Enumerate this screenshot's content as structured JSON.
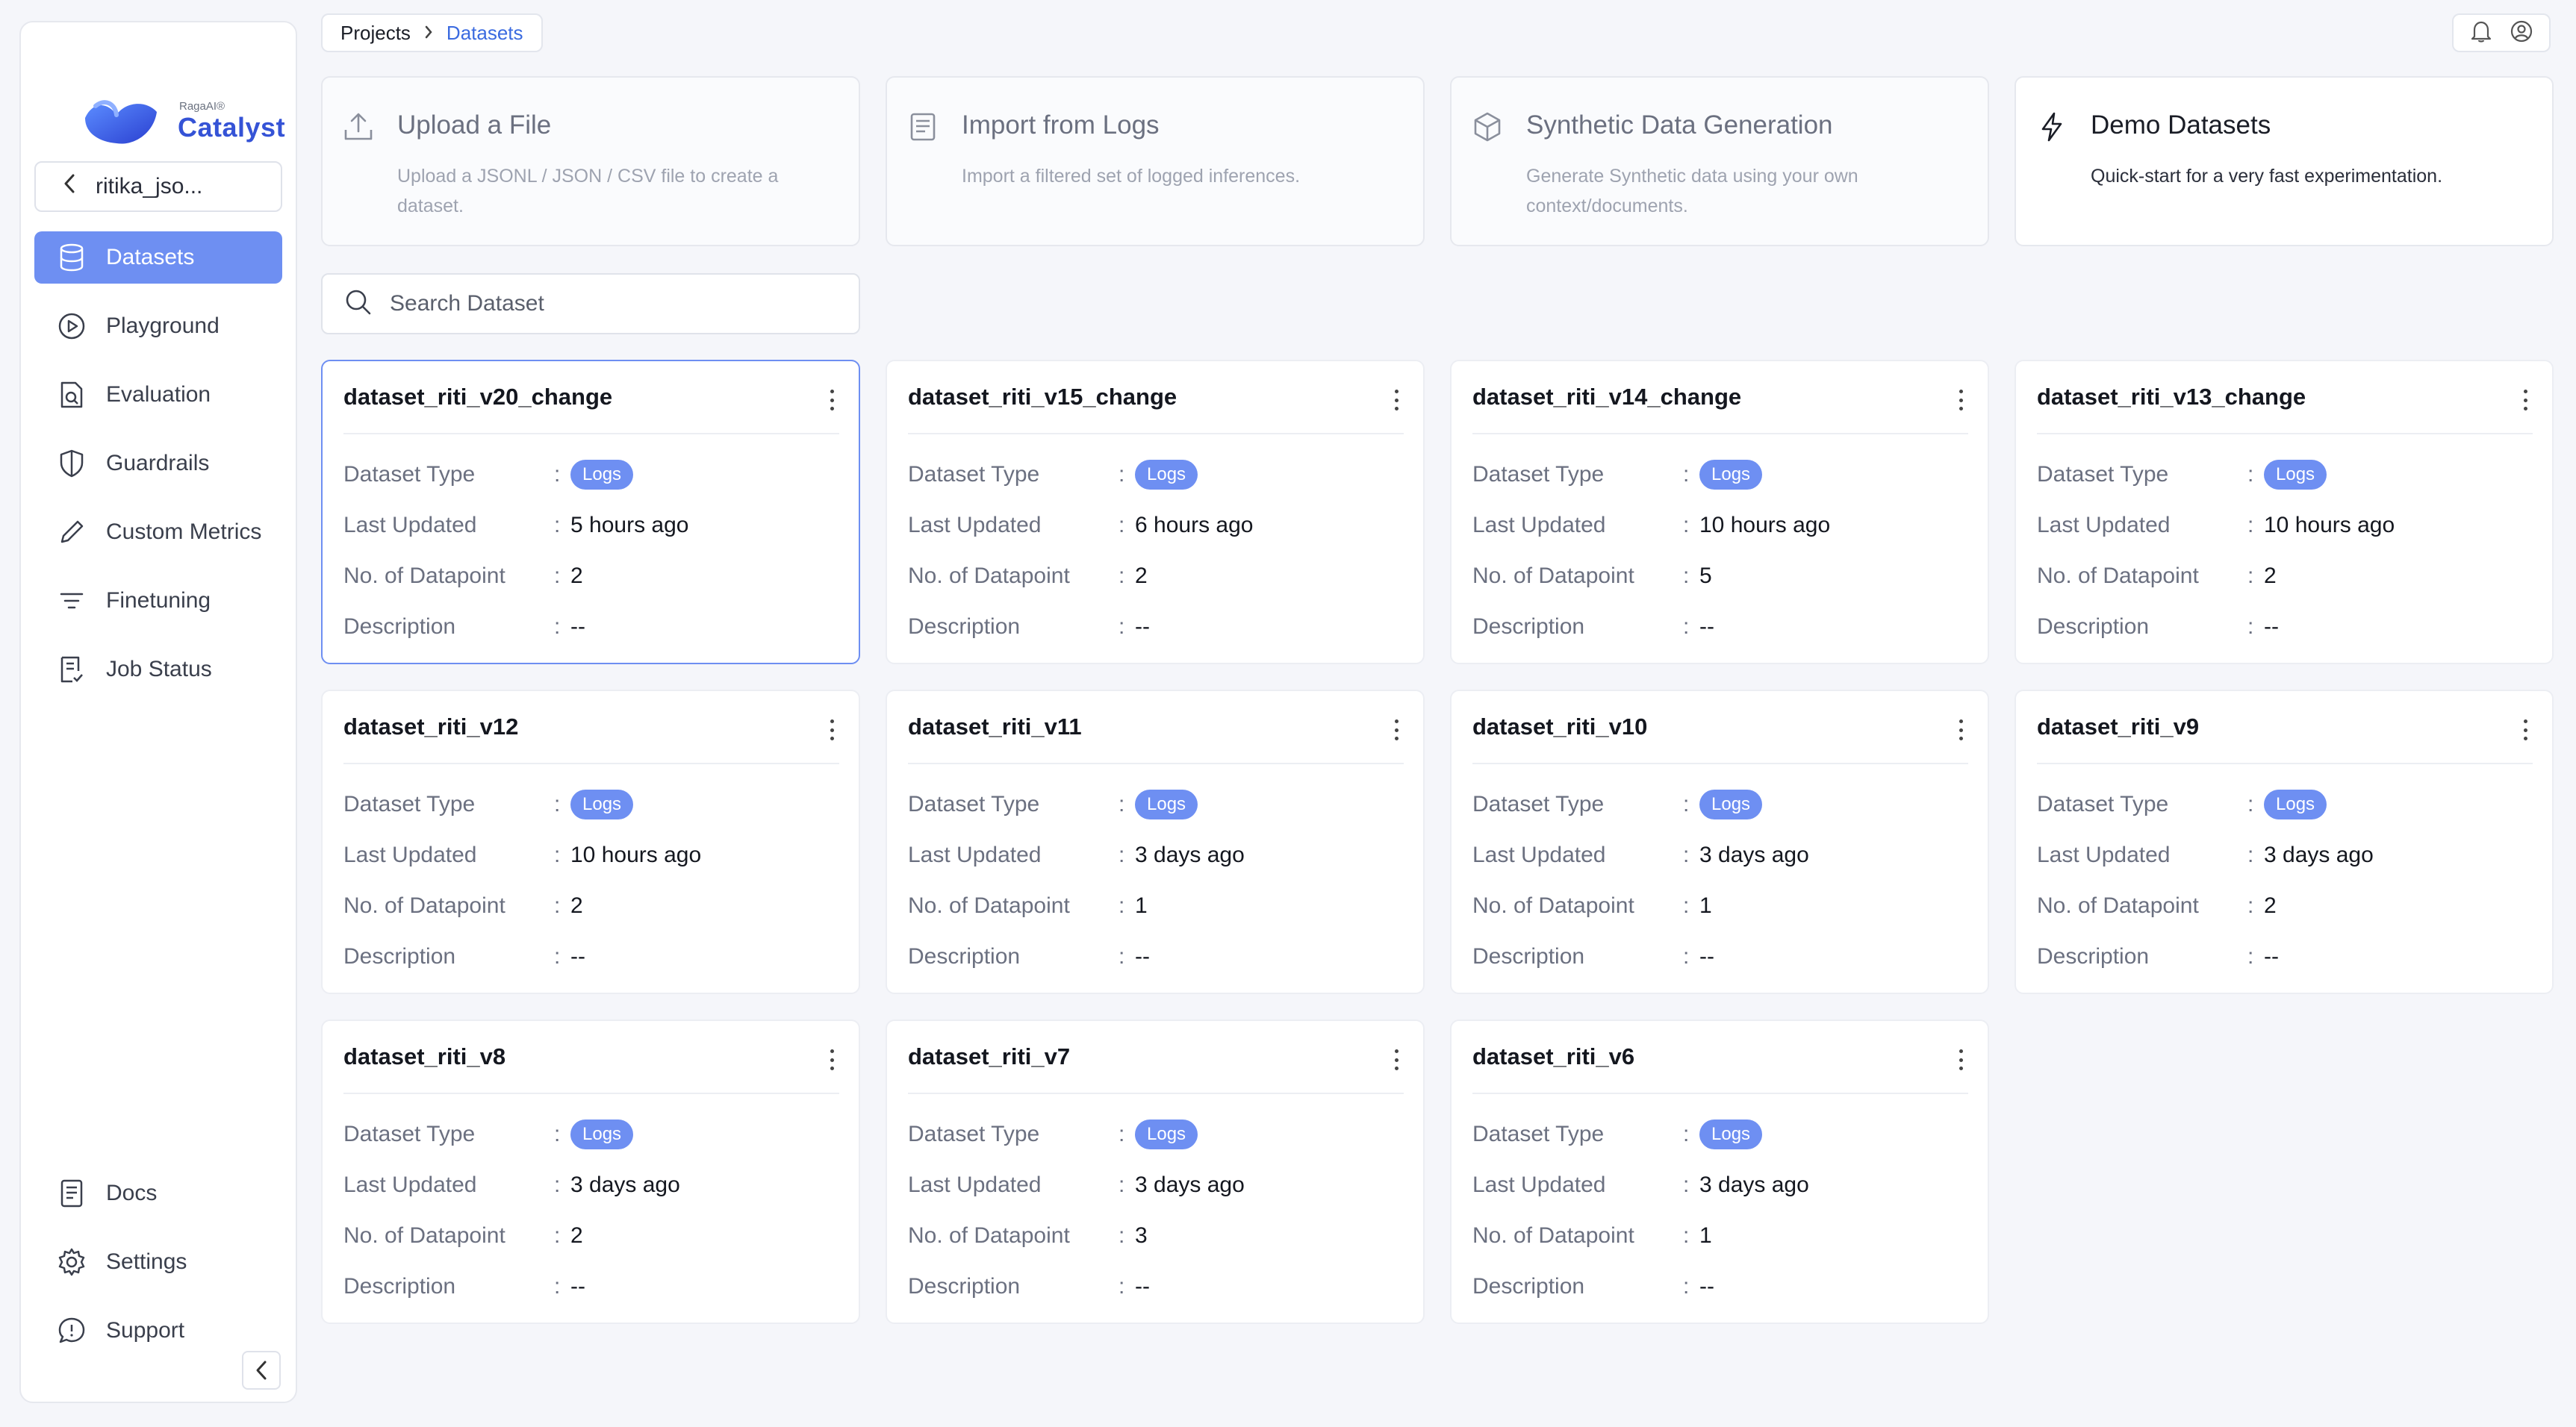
{
  "brand": {
    "small": "RagaAI®",
    "name": "Catalyst"
  },
  "project": {
    "name": "ritika_jso..."
  },
  "nav": {
    "items": [
      {
        "label": "Datasets",
        "icon": "database-icon"
      },
      {
        "label": "Playground",
        "icon": "play-icon"
      },
      {
        "label": "Evaluation",
        "icon": "evaluation-icon"
      },
      {
        "label": "Guardrails",
        "icon": "shield-icon"
      },
      {
        "label": "Custom Metrics",
        "icon": "pencil-icon"
      },
      {
        "label": "Finetuning",
        "icon": "filter-icon"
      },
      {
        "label": "Job Status",
        "icon": "job-icon"
      }
    ],
    "bottom": [
      {
        "label": "Docs",
        "icon": "doc-icon"
      },
      {
        "label": "Settings",
        "icon": "gear-icon"
      },
      {
        "label": "Support",
        "icon": "chat-icon"
      }
    ]
  },
  "breadcrumb": {
    "root": "Projects",
    "current": "Datasets"
  },
  "actions": [
    {
      "title": "Upload a File",
      "desc": "Upload a JSONL / JSON / CSV file to create a dataset.",
      "icon": "upload-icon"
    },
    {
      "title": "Import from Logs",
      "desc": "Import a filtered set of logged inferences.",
      "icon": "logs-icon"
    },
    {
      "title": "Synthetic Data Generation",
      "desc": "Generate Synthetic data using your own context/documents.",
      "icon": "cube-icon"
    },
    {
      "title": "Demo Datasets",
      "desc": "Quick-start for a very fast experimentation.",
      "icon": "bolt-icon"
    }
  ],
  "search": {
    "placeholder": "Search Dataset"
  },
  "labels": {
    "type": "Dataset Type",
    "updated": "Last Updated",
    "datapoints": "No. of Datapoint",
    "description": "Description",
    "colon": ":"
  },
  "datasets": [
    {
      "name": "dataset_riti_v20_change",
      "type": "Logs",
      "updated": "5 hours ago",
      "datapoints": "2",
      "description": "--"
    },
    {
      "name": "dataset_riti_v15_change",
      "type": "Logs",
      "updated": "6 hours ago",
      "datapoints": "2",
      "description": "--"
    },
    {
      "name": "dataset_riti_v14_change",
      "type": "Logs",
      "updated": "10 hours ago",
      "datapoints": "5",
      "description": "--"
    },
    {
      "name": "dataset_riti_v13_change",
      "type": "Logs",
      "updated": "10 hours ago",
      "datapoints": "2",
      "description": "--"
    },
    {
      "name": "dataset_riti_v12",
      "type": "Logs",
      "updated": "10 hours ago",
      "datapoints": "2",
      "description": "--"
    },
    {
      "name": "dataset_riti_v11",
      "type": "Logs",
      "updated": "3 days ago",
      "datapoints": "1",
      "description": "--"
    },
    {
      "name": "dataset_riti_v10",
      "type": "Logs",
      "updated": "3 days ago",
      "datapoints": "1",
      "description": "--"
    },
    {
      "name": "dataset_riti_v9",
      "type": "Logs",
      "updated": "3 days ago",
      "datapoints": "2",
      "description": "--"
    },
    {
      "name": "dataset_riti_v8",
      "type": "Logs",
      "updated": "3 days ago",
      "datapoints": "2",
      "description": "--"
    },
    {
      "name": "dataset_riti_v7",
      "type": "Logs",
      "updated": "3 days ago",
      "datapoints": "3",
      "description": "--"
    },
    {
      "name": "dataset_riti_v6",
      "type": "Logs",
      "updated": "3 days ago",
      "datapoints": "1",
      "description": "--"
    }
  ],
  "colors": {
    "accent": "#6e8ff2",
    "brand": "#3553d6",
    "link": "#3b6be0"
  }
}
